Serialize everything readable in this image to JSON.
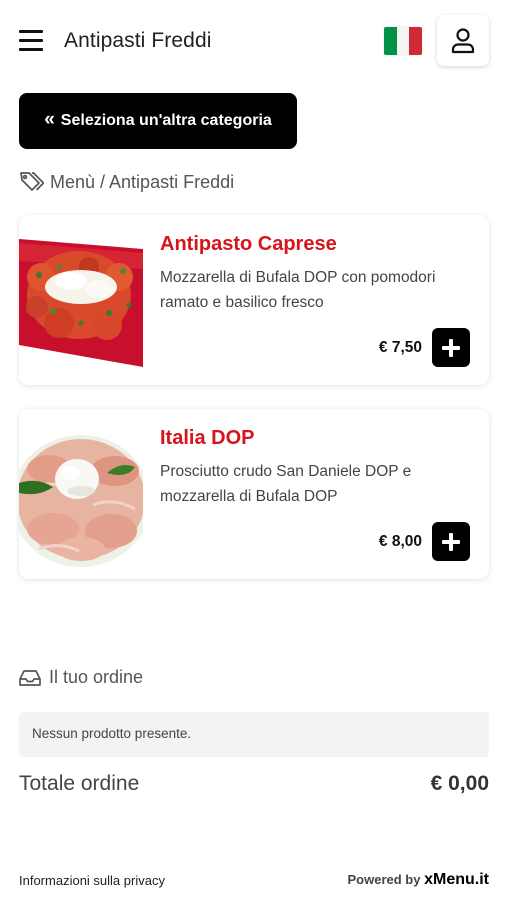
{
  "header": {
    "title": "Antipasti Freddi",
    "menu_icon": "hamburger-menu-icon",
    "language_icon": "italian-flag-icon",
    "user_icon": "user-icon",
    "flag_colors": [
      "#009246",
      "#ffffff",
      "#ce2b37"
    ]
  },
  "category_button": {
    "chevron": "«",
    "label": "Seleziona un'altra categoria"
  },
  "breadcrumb": {
    "icon": "tags-icon",
    "text": "Menù / Antipasti Freddi"
  },
  "products": [
    {
      "name": "Antipasto Caprese",
      "description": "Mozzarella di Bufala DOP con pomodori ramato e basilico fresco",
      "price": "€ 7,50",
      "image": "caprese-photo"
    },
    {
      "name": "Italia DOP",
      "description": "Prosciutto crudo San Daniele DOP e mozzarella di Bufala DOP",
      "price": "€ 8,00",
      "image": "prosciutto-mozzarella-photo"
    }
  ],
  "order": {
    "icon": "inbox-tray-icon",
    "heading": "Il tuo ordine",
    "empty_message": "Nessun prodotto presente.",
    "total_label": "Totale ordine",
    "total_value": "€ 0,00"
  },
  "footer": {
    "privacy_link": "Informazioni sulla privacy",
    "powered_by": "Powered by",
    "brand": "xMenu.it"
  },
  "colors": {
    "product_name": "#d7141a",
    "button_bg": "#000000",
    "empty_box_bg": "#f3f3f3"
  }
}
